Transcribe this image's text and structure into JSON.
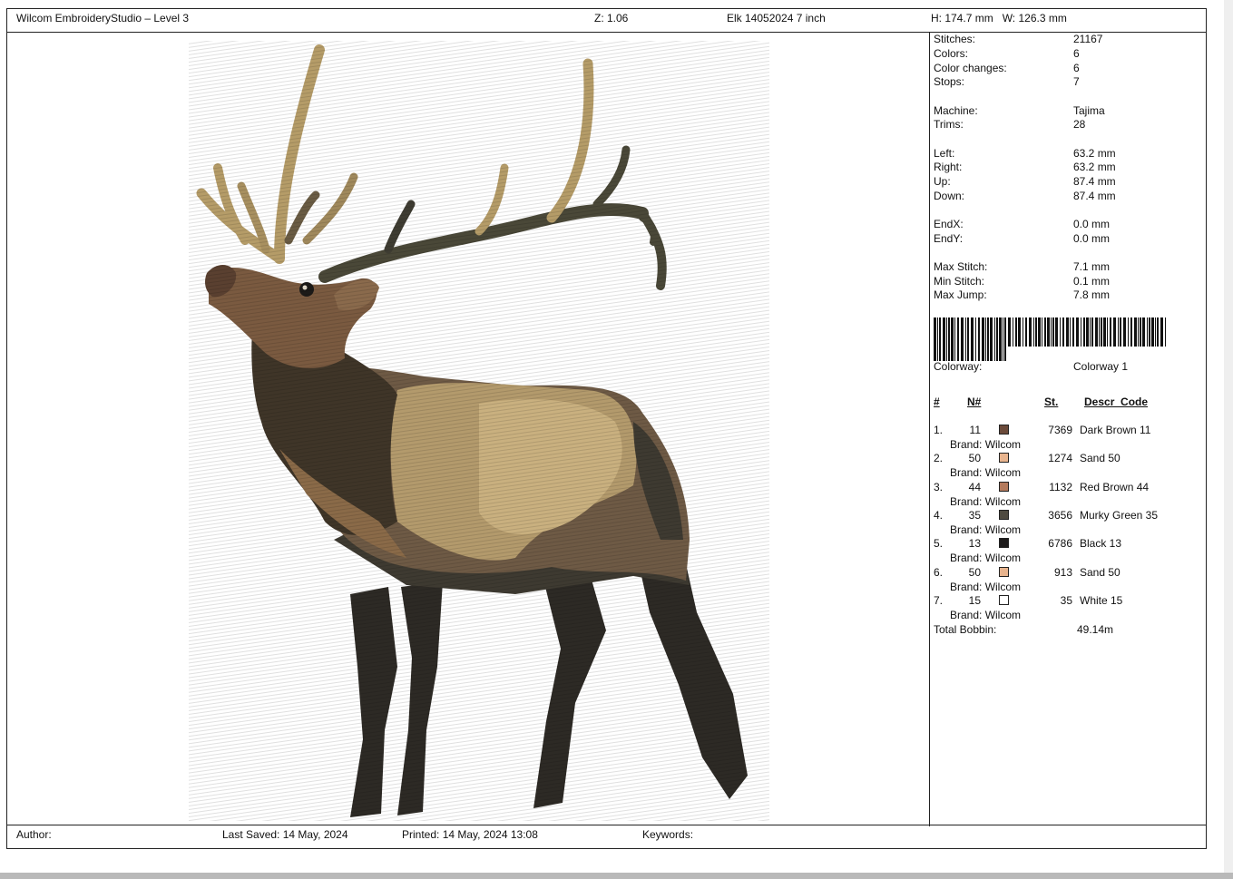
{
  "header": {
    "app_title": "Wilcom EmbroideryStudio – Level 3",
    "zoom": "Z: 1.06",
    "design_name": "Elk 14052024 7 inch",
    "dimensions": "H: 174.7 mm   W: 126.3 mm"
  },
  "stats": [
    {
      "label": "Stitches:",
      "value": "21167"
    },
    {
      "label": "Colors:",
      "value": "6"
    },
    {
      "label": "Color changes:",
      "value": "6"
    },
    {
      "label": "Stops:",
      "value": "7"
    },
    {
      "label": "Machine:",
      "value": "Tajima"
    },
    {
      "label": "Trims:",
      "value": "28"
    },
    {
      "label": "Left:",
      "value": "63.2 mm"
    },
    {
      "label": "Right:",
      "value": "63.2 mm"
    },
    {
      "label": "Up:",
      "value": "87.4 mm"
    },
    {
      "label": "Down:",
      "value": "87.4 mm"
    },
    {
      "label": "EndX:",
      "value": "0.0 mm"
    },
    {
      "label": "EndY:",
      "value": "0.0 mm"
    },
    {
      "label": "Max Stitch:",
      "value": "7.1 mm"
    },
    {
      "label": "Min Stitch:",
      "value": "0.1 mm"
    },
    {
      "label": "Max Jump:",
      "value": "7.8 mm"
    }
  ],
  "colorway": {
    "label": "Colorway:",
    "value": "Colorway 1"
  },
  "color_table": {
    "headers": {
      "index": "#",
      "number": "N#",
      "stitches": "St.",
      "description": "Descr  Code"
    },
    "rows": [
      {
        "index": "1.",
        "number": "11",
        "swatch": "#6b4a3a",
        "stitches": "7369",
        "description": "Dark Brown 11",
        "brand": "Brand: Wilcom"
      },
      {
        "index": "2.",
        "number": "50",
        "swatch": "#e8b48e",
        "stitches": "1274",
        "description": "Sand 50",
        "brand": "Brand: Wilcom"
      },
      {
        "index": "3.",
        "number": "44",
        "swatch": "#b47a5c",
        "stitches": "1132",
        "description": "Red Brown 44",
        "brand": "Brand: Wilcom"
      },
      {
        "index": "4.",
        "number": "35",
        "swatch": "#4e4a40",
        "stitches": "3656",
        "description": "Murky Green 35",
        "brand": "Brand: Wilcom"
      },
      {
        "index": "5.",
        "number": "13",
        "swatch": "#1e1c1c",
        "stitches": "6786",
        "description": "Black 13",
        "brand": "Brand: Wilcom"
      },
      {
        "index": "6.",
        "number": "50",
        "swatch": "#e8b48e",
        "stitches": "913",
        "description": "Sand 50",
        "brand": "Brand: Wilcom"
      },
      {
        "index": "7.",
        "number": "15",
        "swatch": "#ffffff",
        "stitches": "35",
        "description": "White 15",
        "brand": "Brand: Wilcom"
      }
    ]
  },
  "total_bobbin": {
    "label": "Total Bobbin:",
    "value": "49.14m"
  },
  "footer": {
    "author": "Author:",
    "last_saved": "Last Saved: 14 May, 2024",
    "printed": "Printed: 14 May, 2024 13:08",
    "keywords": "Keywords:"
  }
}
